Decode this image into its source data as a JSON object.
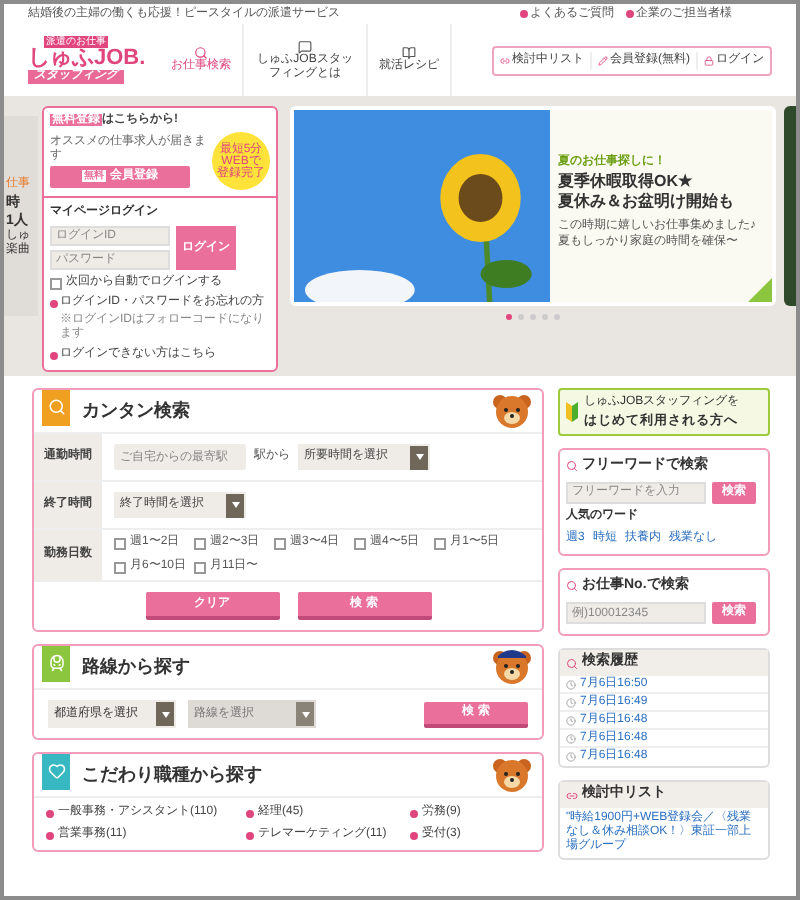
{
  "header": {
    "tagline": "結婚後の主婦の働くも応援！ピースタイルの派遣サービス",
    "top_links": [
      "よくあるご質問",
      "企業のご担当者様"
    ],
    "logo": {
      "badge": "派遣のお仕事",
      "main": "しゅふJOB.",
      "sub": "スタッフィング"
    },
    "nav": [
      {
        "label": "お仕事検索",
        "selected": true
      },
      {
        "label": "しゅふJOBスタッフィングとは",
        "selected": false
      },
      {
        "label": "就活レシピ",
        "selected": false
      }
    ],
    "actions": [
      "検討中リスト",
      "会員登録(無料)",
      "ログイン"
    ]
  },
  "prev_slide": {
    "label": "仕事",
    "lines": [
      "時",
      "1人"
    ],
    "body": [
      "しゅ",
      "楽曲"
    ]
  },
  "register": {
    "title_strong": "無料登録",
    "title_rest": "はこちらから!",
    "note": "オススメの仕事求人が届きます",
    "button_tag": "無料",
    "button": "会員登録",
    "sticker": "最短5分WEBで登録完了"
  },
  "login": {
    "title": "マイページログイン",
    "id_placeholder": "ログインID",
    "pw_placeholder": "パスワード",
    "button": "ログイン",
    "auto": {
      "label": "次回から自動でログインする",
      "checked": false
    },
    "links": [
      "ログインID・パスワードをお忘れの方",
      "ログインできない方はこちら"
    ],
    "note": "※ログインIDはフォローコードになります"
  },
  "slide": {
    "kicker": "夏のお仕事探しに！",
    "title": [
      "夏季休暇取得OK★",
      "夏休み＆お盆明け開始も"
    ],
    "body": [
      "この時期に嬉しいお仕事集めました♪",
      "夏もしっかり家庭の時間を確保〜"
    ]
  },
  "slide_dots": [
    {
      "selected": true
    },
    {
      "selected": false
    },
    {
      "selected": false
    },
    {
      "selected": false
    },
    {
      "selected": false
    }
  ],
  "easy_search": {
    "title": "カンタン検索",
    "commute": {
      "label": "通勤時間",
      "station_placeholder": "ご自宅からの最寄駅",
      "from": "駅から",
      "select": "所要時間を選択"
    },
    "end_time": {
      "label": "終了時間",
      "select": "終了時間を選択"
    },
    "days": {
      "label": "勤務日数",
      "options": [
        {
          "label": "週1〜2日",
          "checked": false
        },
        {
          "label": "週2〜3日",
          "checked": false
        },
        {
          "label": "週3〜4日",
          "checked": false
        },
        {
          "label": "週4〜5日",
          "checked": false
        },
        {
          "label": "月1〜5日",
          "checked": false
        },
        {
          "label": "月6〜10日",
          "checked": false
        },
        {
          "label": "月11日〜",
          "checked": false
        }
      ]
    },
    "clear": "クリア",
    "search": "検 索"
  },
  "route": {
    "title": "路線から探す",
    "prefecture": {
      "label": "都道府県を選択",
      "disabled": false
    },
    "line": {
      "label": "路線を選択",
      "disabled": true
    },
    "search": "検 索"
  },
  "category": {
    "title": "こだわり職種から探す",
    "items": [
      "一般事務・アシスタント(110)",
      "経理(45)",
      "労務(9)",
      "営業事務(11)",
      "テレマーケティング(11)",
      "受付(3)"
    ]
  },
  "first_time": {
    "line1": "しゅふJOBスタッフィングを",
    "line2": "はじめて利用される方へ"
  },
  "free_word": {
    "title": "フリーワードで検索",
    "placeholder": "フリーワードを入力",
    "button": "検索",
    "popular_title": "人気のワード",
    "popular": [
      "週3",
      "時短",
      "扶養内",
      "残業なし"
    ]
  },
  "job_no": {
    "title": "お仕事No.で検索",
    "placeholder": "例)100012345",
    "button": "検索"
  },
  "history": {
    "title": "検索履歴",
    "items": [
      "7月6日16:50",
      "7月6日16:49",
      "7月6日16:48",
      "7月6日16:48",
      "7月6日16:48"
    ]
  },
  "pick_list": {
    "title": "検討中リスト",
    "item": "\"時給1900円+WEB登録会／〈残業なし＆休み相談OK！〉東証一部上場グループ"
  }
}
